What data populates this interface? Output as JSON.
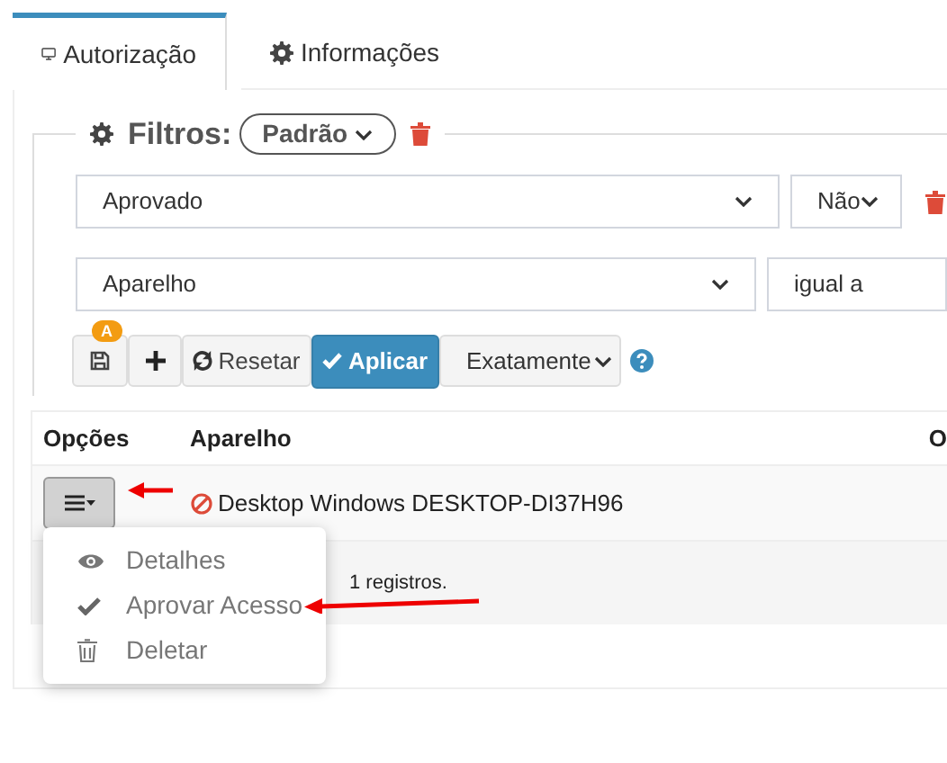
{
  "tabs": [
    {
      "label": "Autorização",
      "selected": true,
      "kind": "monitor"
    },
    {
      "label": "Informações",
      "selected": false,
      "kind": "gear"
    }
  ],
  "filters": {
    "title": "Filtros:",
    "preset": "Padrão",
    "rows": [
      {
        "field": "Aprovado",
        "operator": "Não",
        "removable": true
      },
      {
        "field": "Aparelho",
        "operator": "igual a",
        "removable": false
      }
    ],
    "save_badge": "A",
    "reset": "Resetar",
    "apply": "Aplicar",
    "match": "Exatamente"
  },
  "table": {
    "columns": [
      "Opções",
      "Aparelho",
      "O"
    ],
    "rows": [
      {
        "device": "Desktop Windows DESKTOP-DI37H96",
        "blocked": true
      }
    ],
    "footer": "1 registros."
  },
  "menu": {
    "items": [
      {
        "label": "Detalhes",
        "kind": "view"
      },
      {
        "label": "Aprovar Acesso",
        "kind": "approve"
      },
      {
        "label": "Deletar",
        "kind": "delete"
      }
    ]
  }
}
